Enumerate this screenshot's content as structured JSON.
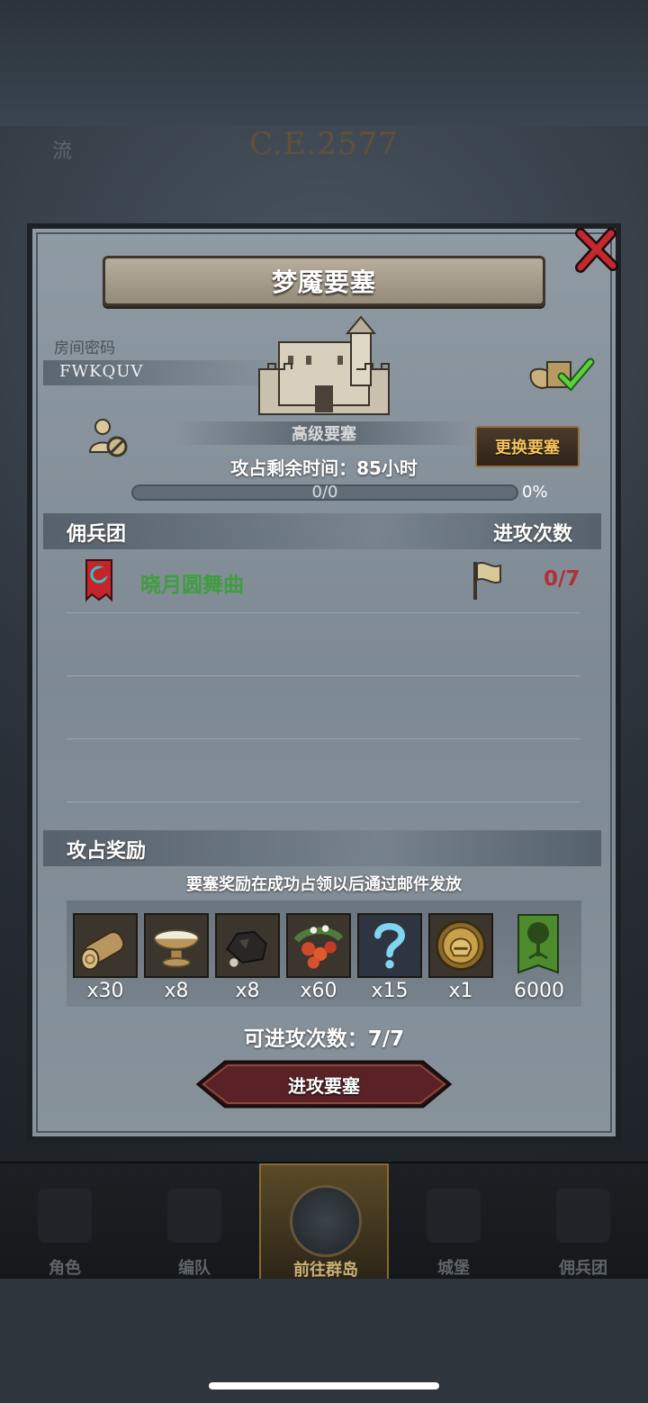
{
  "background": {
    "era": "C.E.2577",
    "left_text": "流"
  },
  "dialog": {
    "title": "梦魇要塞",
    "room_label": "房间密码",
    "room_code": "FWKQUV",
    "fortress_name": "高级要塞",
    "change_button": "更换要塞",
    "remaining_time_label": "攻占剩余时间：",
    "remaining_time_value": "85",
    "remaining_time_unit": "小时",
    "progress_text": "0/0",
    "progress_percent": "0%",
    "progress_fraction": 0,
    "guild_header": "佣兵团",
    "attacks_header": "进攻次数",
    "guilds": [
      {
        "name": "晓月圆舞曲",
        "attacks": "0/7",
        "name_color": "#3e9e3e"
      }
    ],
    "rewards_header": "攻占奖励",
    "rewards_note": "要塞奖励在成功占领以后通过邮件发放",
    "rewards": [
      {
        "icon": "log-icon",
        "qty": "x30"
      },
      {
        "icon": "bowl-icon",
        "qty": "x8"
      },
      {
        "icon": "ore-icon",
        "qty": "x8"
      },
      {
        "icon": "berries-icon",
        "qty": "x60"
      },
      {
        "icon": "mystery-icon",
        "qty": "x15"
      },
      {
        "icon": "helmet-medal-icon",
        "qty": "x1"
      },
      {
        "icon": "tree-banner-icon",
        "qty": "6000"
      }
    ],
    "attempts_label": "可进攻次数：",
    "attempts_value": "7/7",
    "attack_button": "进攻要塞"
  },
  "nav": [
    {
      "label": "角色",
      "active": false
    },
    {
      "label": "编队",
      "active": false
    },
    {
      "label": "前往群岛",
      "active": true
    },
    {
      "label": "城堡",
      "active": false
    },
    {
      "label": "佣兵团",
      "active": false
    }
  ],
  "colors": {
    "accent_gold": "#f6c35c",
    "guild_green": "#3e9e3e",
    "attack_red": "#b0303a",
    "button_red": "#5a2226"
  }
}
